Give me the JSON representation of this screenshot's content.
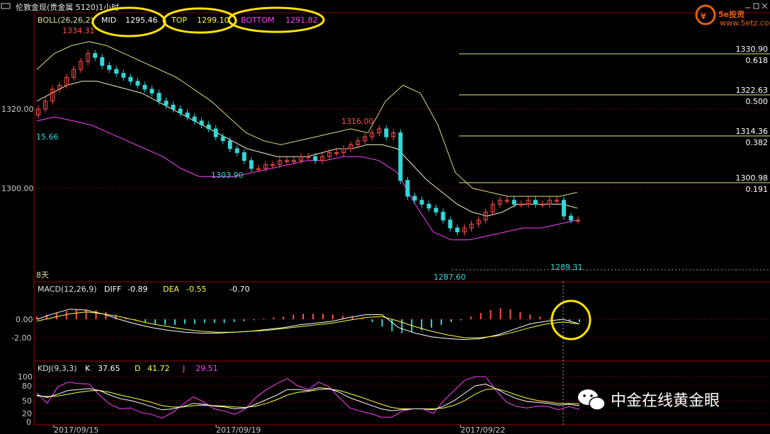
{
  "header": {
    "title_icon": "window-icon",
    "title": "伦敦金现(贵金属 5120)1小时",
    "controls": [
      "minimize-icon",
      "restore-icon",
      "close-icon"
    ]
  },
  "colors": {
    "background": "#000000",
    "up_candle": "#ff4b4b",
    "down_candle": "#35d6d6",
    "mid_line": "#f0f0c8",
    "top_line": "#dcdc78",
    "bottom_line": "#ff40ff",
    "fib_line": "#e8e880",
    "highlight_circle": "#ffe400",
    "grid": "#7a0000",
    "text_cyan": "#38d7d7",
    "text_red": "#ff5050"
  },
  "boll": {
    "label": "BOLL(26,26,2)",
    "mid_label": "MID",
    "mid_value": "1295.46",
    "top_label": "TOP",
    "top_value": "1299.10",
    "bottom_label": "BOTTOM",
    "bottom_value": "1291.82"
  },
  "macd": {
    "label": "MACD(12,26,9)",
    "diff_label": "DIFF",
    "diff_value": "-0.89",
    "dea_label": "DEA",
    "dea_value": "-0.55",
    "macd_value": "-0.70"
  },
  "kdj": {
    "label": "KDJ(9,3,3)",
    "k_label": "K",
    "k_value": "37.65",
    "d_label": "D",
    "d_value": "41.72",
    "j_label": "J",
    "j_value": "29.51"
  },
  "logo": {
    "text": "5e投资",
    "url": "www.5etz.com"
  },
  "watermark": {
    "icon": "wechat-icon",
    "text": "中金在线黄金眼"
  },
  "marker_label": "8天",
  "chart_data": [
    {
      "type": "line",
      "panel": "price",
      "y_axis_labels": [
        "1320.00",
        "1300.00"
      ],
      "ylim": [
        1286,
        1338
      ],
      "x_axis_labels": [
        "2017/09/15",
        "2017/09/19",
        "2017/09/22"
      ],
      "price_annotations": [
        {
          "text": "1334.31",
          "kind": "high"
        },
        {
          "text": "15.66",
          "kind": "low"
        },
        {
          "text": "1303.90",
          "kind": "low"
        },
        {
          "text": "1316.00",
          "kind": "high"
        },
        {
          "text": "1287.60",
          "kind": "low"
        },
        {
          "text": "1289.31",
          "kind": "low"
        }
      ],
      "fibonacci": [
        {
          "price": "1330.90",
          "ratio": "0.618"
        },
        {
          "price": "1322.63",
          "ratio": "0.500"
        },
        {
          "price": "1314.36",
          "ratio": "0.382"
        },
        {
          "price": "1300.98",
          "ratio": "0.191"
        }
      ],
      "candles_close": [
        1320,
        1322,
        1325,
        1326,
        1328,
        1330,
        1332,
        1334,
        1333,
        1331,
        1330,
        1329,
        1328,
        1327,
        1326,
        1325,
        1324,
        1322,
        1321,
        1320,
        1319,
        1318,
        1317,
        1316,
        1315,
        1313,
        1312,
        1310,
        1309,
        1307,
        1305,
        1305,
        1306,
        1306,
        1307,
        1307,
        1307,
        1308,
        1308,
        1307,
        1308,
        1309,
        1309,
        1310,
        1311,
        1312,
        1313,
        1314,
        1315,
        1313,
        1314,
        1302,
        1298,
        1297,
        1296,
        1295,
        1294,
        1292,
        1290,
        1289,
        1290,
        1291,
        1292,
        1294,
        1296,
        1297,
        1297,
        1296,
        1296,
        1297,
        1296,
        1296,
        1297,
        1297,
        1293,
        1292,
        1292
      ],
      "mid": [
        1322,
        1324,
        1326,
        1327,
        1327,
        1326,
        1325,
        1324,
        1322,
        1320,
        1318,
        1316,
        1314,
        1312,
        1310,
        1309,
        1308,
        1308,
        1308,
        1309,
        1310,
        1310,
        1311,
        1311,
        1310,
        1306,
        1302,
        1299,
        1296,
        1294,
        1293,
        1294,
        1296,
        1296,
        1296,
        1296,
        1295
      ],
      "top": [
        1330,
        1334,
        1336,
        1337,
        1336,
        1334,
        1332,
        1330,
        1328,
        1325,
        1322,
        1318,
        1314,
        1312,
        1311,
        1312,
        1313,
        1314,
        1315,
        1314,
        1322,
        1326,
        1324,
        1316,
        1304,
        1300,
        1299,
        1298,
        1298,
        1298,
        1298,
        1299
      ],
      "bottom": [
        1317,
        1318,
        1317,
        1316,
        1314,
        1312,
        1310,
        1308,
        1305,
        1303,
        1303,
        1303,
        1304,
        1305,
        1306,
        1307,
        1307,
        1308,
        1308,
        1307,
        1304,
        1296,
        1289,
        1287,
        1287,
        1288,
        1289,
        1290,
        1290,
        1291,
        1292
      ]
    },
    {
      "type": "bar",
      "panel": "macd",
      "y_axis_labels": [
        "0.00",
        "-2.00"
      ],
      "ylim": [
        -2.6,
        1.6
      ],
      "histogram": [
        0.3,
        0.5,
        0.7,
        0.9,
        1.1,
        1.1,
        1.0,
        0.8,
        0.5,
        0.2,
        -0.1,
        -0.3,
        -0.5,
        -0.6,
        -0.6,
        -0.5,
        -0.5,
        -0.4,
        -0.4,
        -0.4,
        -0.3,
        -0.2,
        -0.1,
        0.1,
        0.2,
        0.3,
        0.5,
        0.6,
        0.6,
        0.6,
        0.5,
        0.4,
        0.3,
        0.1,
        -0.3,
        -0.8,
        -1.3,
        -1.5,
        -1.4,
        -1.2,
        -0.9,
        -0.6,
        -0.3,
        -0.1,
        0.3,
        0.7,
        1.0,
        1.2,
        1.1,
        0.8,
        0.5,
        0.3,
        0.1,
        -0.1,
        -0.2,
        -0.3
      ],
      "diff": [
        0.0,
        0.6,
        1.1,
        1.0,
        0.6,
        0.0,
        -0.5,
        -0.9,
        -1.2,
        -1.4,
        -1.5,
        -1.5,
        -1.4,
        -1.3,
        -1.1,
        -0.9,
        -0.6,
        -0.4,
        -0.2,
        0.2,
        0.5,
        0.5,
        -0.9,
        -1.5,
        -1.9,
        -2.1,
        -2.2,
        -2.1,
        -1.7,
        -1.1,
        -0.5,
        -0.2,
        0.0,
        -0.5
      ],
      "dea": [
        -0.2,
        0.2,
        0.6,
        0.8,
        0.6,
        0.3,
        -0.1,
        -0.5,
        -0.8,
        -1.1,
        -1.3,
        -1.4,
        -1.4,
        -1.3,
        -1.2,
        -1.0,
        -0.8,
        -0.6,
        -0.4,
        -0.1,
        0.2,
        0.3,
        -0.2,
        -0.8,
        -1.3,
        -1.7,
        -2.0,
        -2.0,
        -1.8,
        -1.4,
        -0.9,
        -0.5,
        -0.3,
        -0.5
      ]
    },
    {
      "type": "line",
      "panel": "kdj",
      "y_axis_labels": [
        "100",
        "80",
        "50",
        "20",
        "0"
      ],
      "ylim": [
        0,
        105
      ],
      "k": [
        60,
        55,
        62,
        70,
        72,
        74,
        70,
        60,
        52,
        48,
        42,
        35,
        28,
        30,
        35,
        42,
        40,
        36,
        34,
        30,
        32,
        40,
        50,
        60,
        72,
        72,
        70,
        76,
        74,
        66,
        54,
        46,
        38,
        30,
        26,
        28,
        30,
        30,
        28,
        36,
        48,
        64,
        80,
        84,
        74,
        62,
        52,
        46,
        44,
        42,
        38,
        40,
        37
      ],
      "d": [
        58,
        57,
        58,
        62,
        66,
        69,
        70,
        66,
        60,
        55,
        50,
        44,
        37,
        34,
        34,
        37,
        38,
        37,
        36,
        34,
        33,
        36,
        42,
        50,
        60,
        66,
        68,
        72,
        73,
        70,
        63,
        56,
        48,
        40,
        33,
        30,
        30,
        30,
        30,
        32,
        38,
        48,
        62,
        72,
        74,
        68,
        60,
        53,
        48,
        45,
        42,
        42,
        41
      ],
      "j": [
        65,
        42,
        78,
        88,
        85,
        84,
        60,
        40,
        30,
        32,
        22,
        18,
        10,
        22,
        40,
        56,
        45,
        30,
        25,
        18,
        30,
        55,
        72,
        85,
        96,
        80,
        72,
        88,
        78,
        54,
        32,
        25,
        20,
        12,
        12,
        25,
        30,
        30,
        20,
        48,
        70,
        92,
        100,
        100,
        70,
        45,
        35,
        32,
        36,
        35,
        28,
        35,
        29
      ]
    }
  ]
}
